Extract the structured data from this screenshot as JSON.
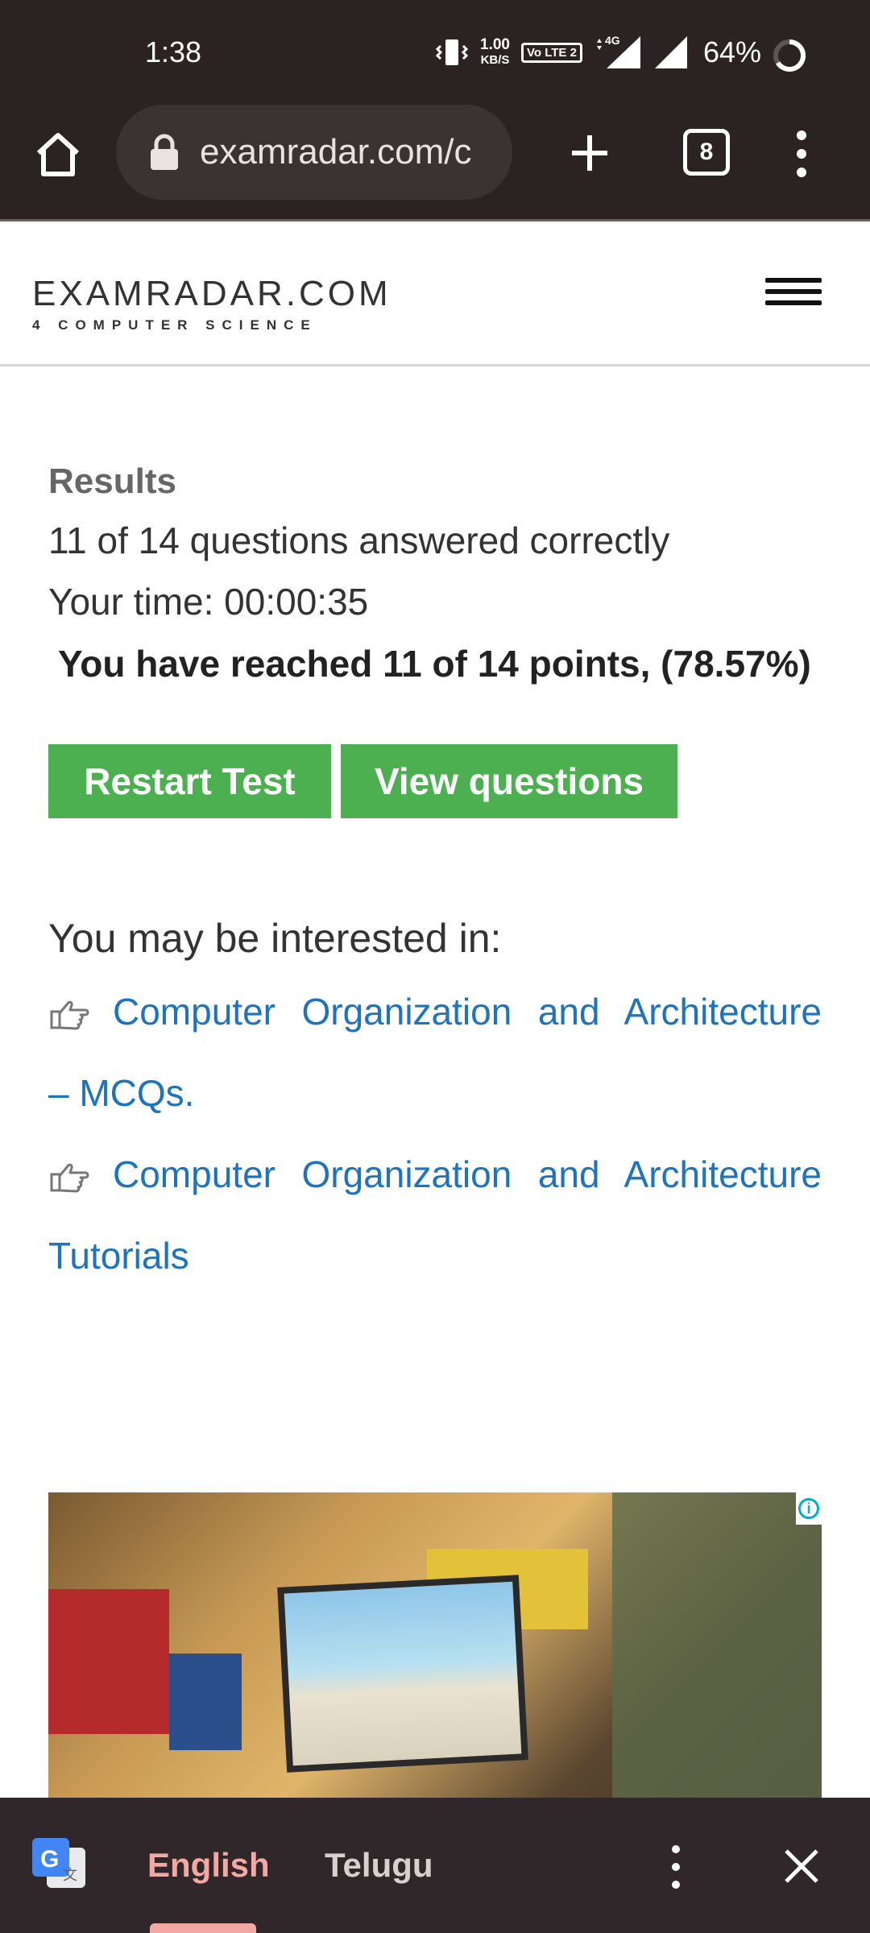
{
  "status_bar": {
    "time": "1:38",
    "net_speed_value": "1.00",
    "net_speed_unit": "KB/S",
    "volte_label": "Vo LTE 2",
    "network_type": "4G",
    "battery_percent": "64%"
  },
  "browser": {
    "url": "examradar.com/c",
    "tab_count": "8",
    "icons": [
      "home-icon",
      "lock-icon",
      "new-tab-plus-icon",
      "tab-switcher-icon",
      "overflow-menu-icon"
    ]
  },
  "site": {
    "logo_main": "EXAMRADAR.COM",
    "logo_sub": "4 COMPUTER SCIENCE",
    "menu_icon": "hamburger-icon"
  },
  "results": {
    "heading": "Results",
    "answered": "11 of 14 questions answered correctly",
    "time": "Your time: 00:00:35",
    "points": "You have reached 11 of 14 points, (78.57%)"
  },
  "actions": {
    "restart": "Restart Test",
    "view": "View questions",
    "button_color": "#4caf50"
  },
  "interested": {
    "title": "You may be interested in:",
    "links": [
      {
        "line1": "Computer Organization and Architecture",
        "line2": "– MCQs."
      },
      {
        "line1": "Computer Organization and Architecture",
        "line2": "Tutorials"
      }
    ],
    "link_color": "#1e73be"
  },
  "ad": {
    "info_icon": "ad-info-icon"
  },
  "translate_bar": {
    "source_language": "English",
    "target_language": "Telugu",
    "active_color": "#f4a8a3"
  }
}
